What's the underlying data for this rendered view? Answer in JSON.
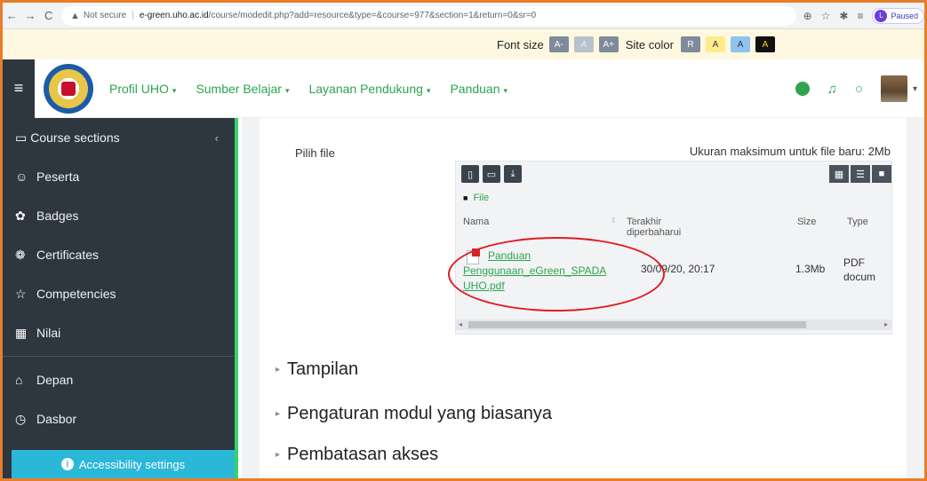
{
  "browser": {
    "back": "←",
    "forward": "→",
    "reload": "C",
    "security_label": "Not secure",
    "url_host": "e-green.uho.ac.id",
    "url_path": "/course/modedit.php?add=resource&type=&course=977&section=1&return=0&sr=0",
    "profile_initial": "L",
    "profile_status": "Paused"
  },
  "a11y_bar": {
    "font_size_label": "Font size",
    "font_buttons": [
      "A-",
      "A",
      "A+"
    ],
    "site_color_label": "Site color",
    "color_buttons": [
      "R",
      "A",
      "A",
      "A"
    ]
  },
  "nav": {
    "links": [
      {
        "label": "Profil UHO",
        "caret": "▾"
      },
      {
        "label": "Sumber Belajar",
        "caret": "▾"
      },
      {
        "label": "Layanan Pendukung",
        "caret": "▾"
      },
      {
        "label": "Panduan",
        "caret": "▾"
      }
    ],
    "accent": "#2ea44f"
  },
  "sidebar": {
    "items": [
      {
        "label": "Course sections",
        "icon": "folder-outline-icon"
      },
      {
        "label": "Peserta",
        "icon": "users-icon"
      },
      {
        "label": "Badges",
        "icon": "badge-icon"
      },
      {
        "label": "Certificates",
        "icon": "certificate-icon"
      },
      {
        "label": "Competencies",
        "icon": "star-icon"
      },
      {
        "label": "Nilai",
        "icon": "gradebook-icon"
      }
    ],
    "bottom_items": [
      {
        "label": "Depan",
        "icon": "home-icon"
      },
      {
        "label": "Dasbor",
        "icon": "dashboard-icon"
      }
    ],
    "accessibility_label": "Accessibility settings"
  },
  "form": {
    "file_label": "Pilih file",
    "max_size_text": "Ukuran maksimum untuk file baru: 2Mb",
    "filepicker": {
      "path_label": "File",
      "columns": [
        "Nama",
        "Terakhir diperbaharui",
        "Size",
        "Type"
      ],
      "file": {
        "name_line1": "Panduan",
        "name_line2": "Penggunaan_eGreen_SPADA",
        "name_line3": "UHO.pdf",
        "modified": "30/09/20, 20:17",
        "size": "1.3Mb",
        "type_line1": "PDF",
        "type_line2": "docum"
      }
    },
    "sections": [
      "Tampilan",
      "Pengaturan modul yang biasanya",
      "Pembatasan akses"
    ]
  },
  "colors": {
    "frame_border": "#e87d2a",
    "sidebar_bg": "#2e3640",
    "sidebar_accent": "#36d26a",
    "accessibility_btn": "#2ab7d8",
    "annotation_circle": "#e21b22"
  }
}
